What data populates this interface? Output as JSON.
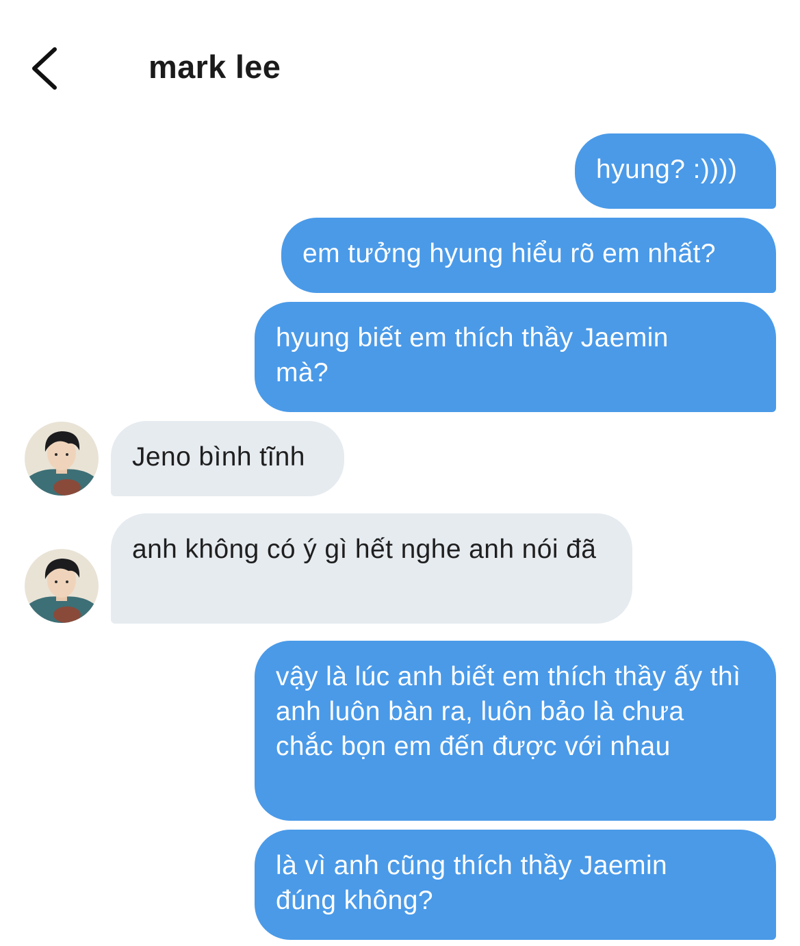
{
  "header": {
    "title": "mark lee",
    "back_icon": "chevron-left-icon"
  },
  "colors": {
    "outgoing_bubble": "#4a9ae8",
    "incoming_bubble": "#e6ebf0",
    "outgoing_text": "#ffffff",
    "incoming_text": "#1f1f1f"
  },
  "messages": [
    {
      "sender": "me",
      "text": "hyung? :))))"
    },
    {
      "sender": "me",
      "text": "em tưởng hyung hiểu rõ em nhất?"
    },
    {
      "sender": "me",
      "text": "hyung biết em thích thầy Jaemin mà?"
    },
    {
      "sender": "them",
      "text": "Jeno bình tĩnh"
    },
    {
      "sender": "them",
      "text": "anh không có ý gì hết nghe anh nói đã"
    },
    {
      "sender": "me",
      "text": "vậy là lúc anh biết em thích thầy ấy thì anh luôn bàn ra, luôn bảo là chưa chắc bọn em đến được với nhau"
    },
    {
      "sender": "me",
      "text": "là vì anh cũng thích thầy Jaemin đúng không?"
    }
  ]
}
